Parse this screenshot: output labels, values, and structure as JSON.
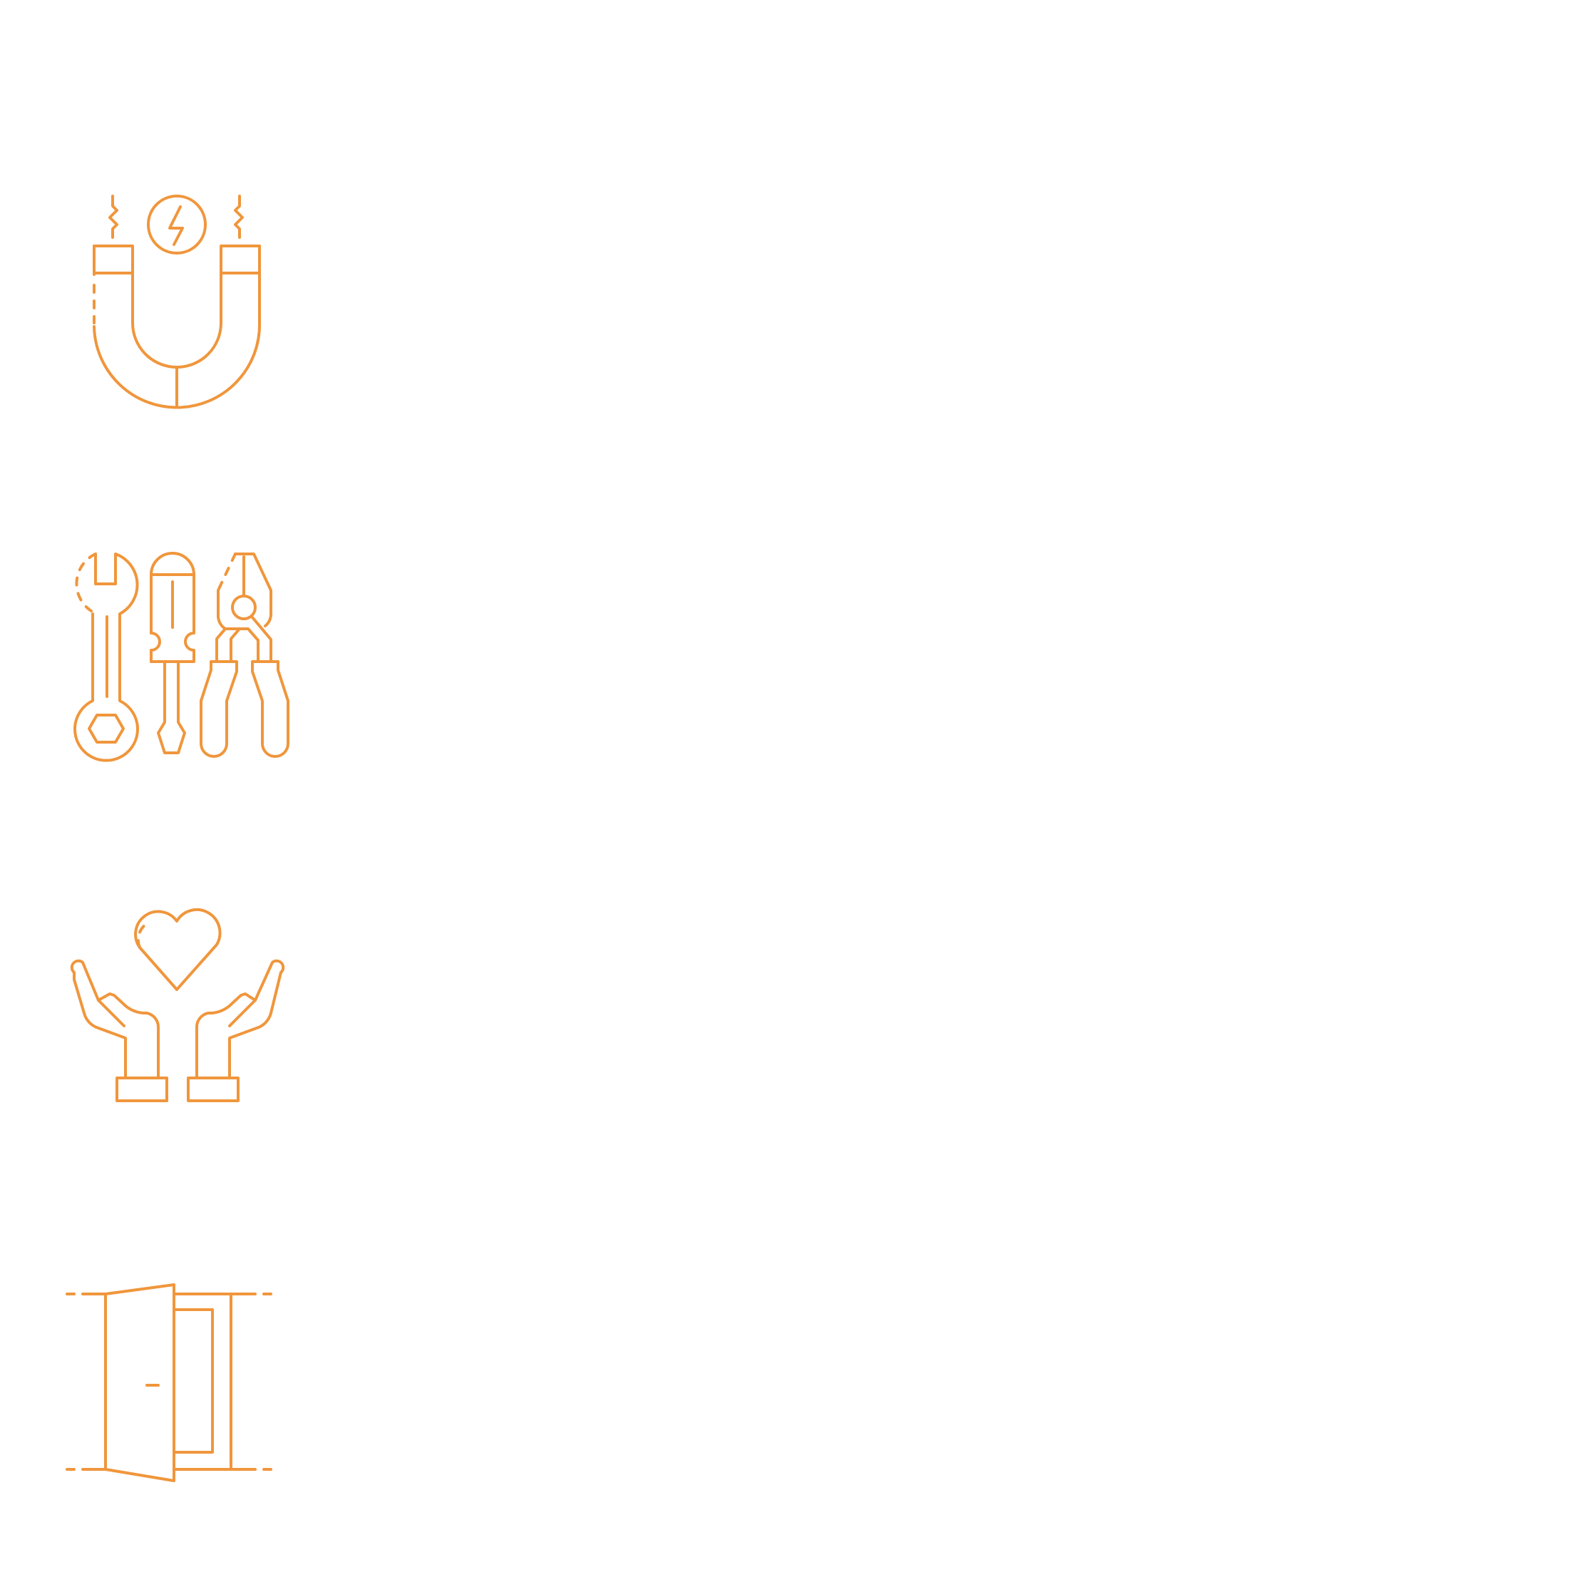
{
  "colors": {
    "background": "#ffffff",
    "icon_stroke": "#F0963C"
  },
  "icons": [
    {
      "name": "magnet-icon"
    },
    {
      "name": "tools-icon"
    },
    {
      "name": "care-hands-heart-icon"
    },
    {
      "name": "open-door-icon"
    }
  ]
}
